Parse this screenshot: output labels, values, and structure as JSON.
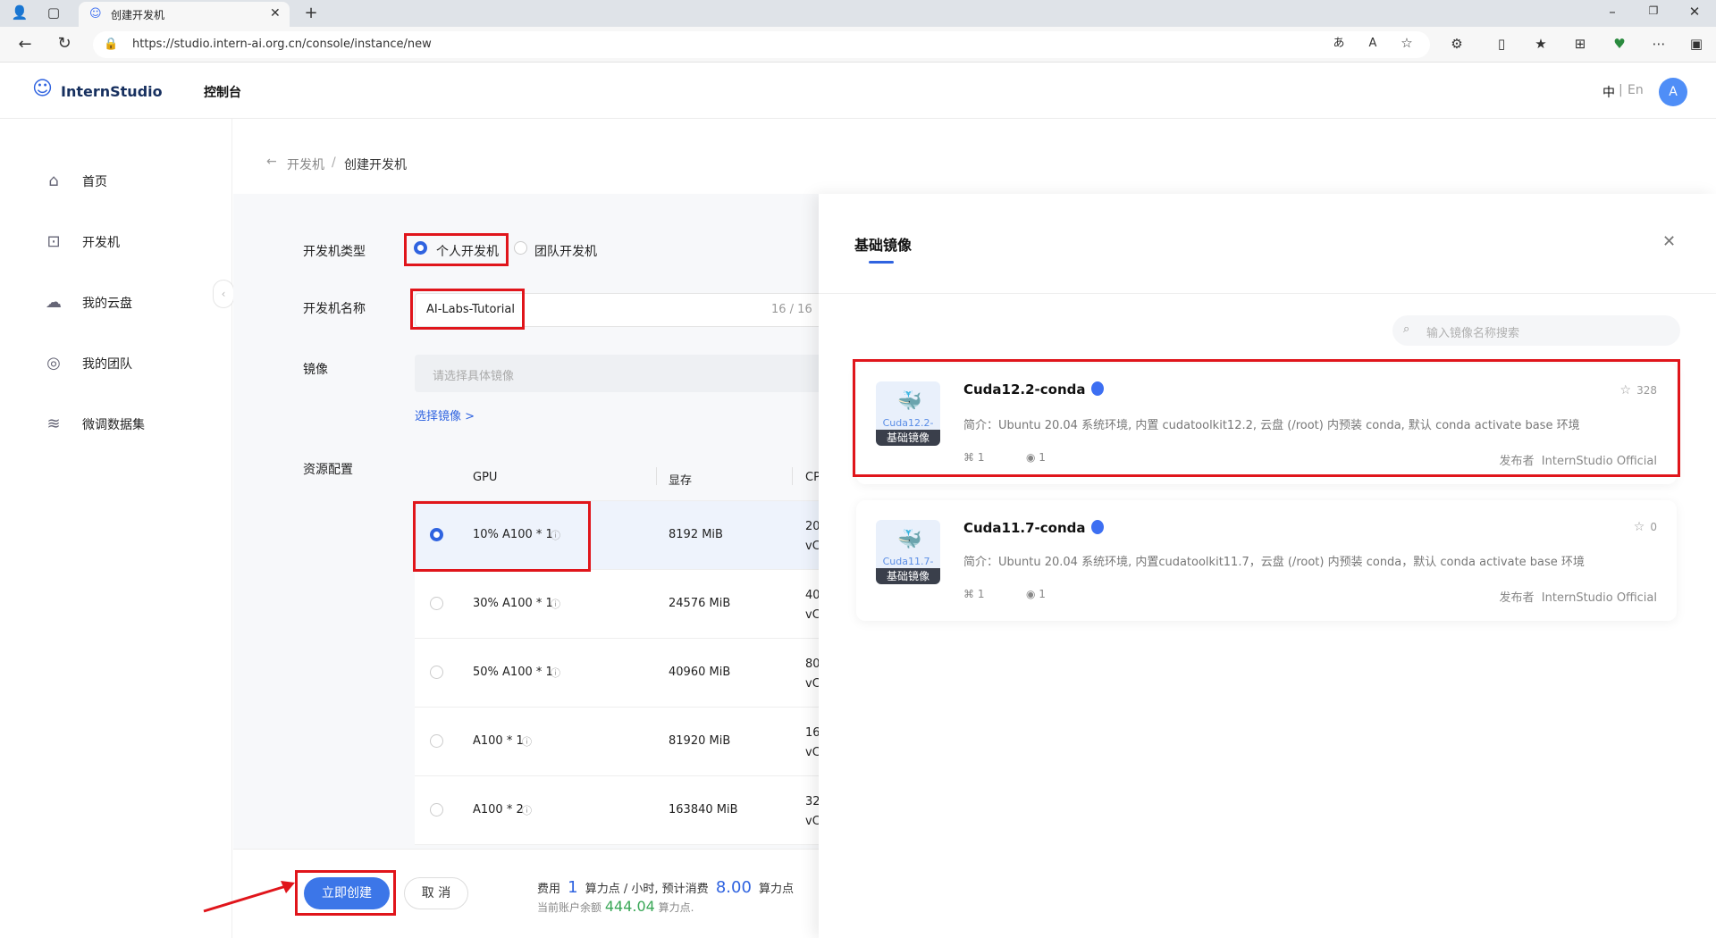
{
  "browser": {
    "tab_title": "创建开发机",
    "url": "https://studio.intern-ai.org.cn/console/instance/new"
  },
  "app": {
    "logo_text": "InternStudio",
    "console_label": "控制台",
    "lang_zh": "中",
    "lang_sep": "|",
    "lang_en": "En",
    "avatar_letter": "A"
  },
  "sidebar": {
    "items": [
      {
        "label": "首页",
        "icon": "home-icon"
      },
      {
        "label": "开发机",
        "icon": "terminal-icon"
      },
      {
        "label": "我的云盘",
        "icon": "cloud-icon"
      },
      {
        "label": "我的团队",
        "icon": "team-icon"
      },
      {
        "label": "微调数据集",
        "icon": "layers-icon"
      }
    ]
  },
  "breadcrumb": {
    "back_icon": "←",
    "parent": "开发机",
    "sep": "/",
    "current": "创建开发机"
  },
  "form": {
    "type_label": "开发机类型",
    "type_personal": "个人开发机",
    "type_team": "团队开发机",
    "name_label": "开发机名称",
    "name_value": "AI-Labs-Tutorial",
    "name_count": "16 / 16",
    "image_label": "镜像",
    "image_placeholder": "请选择具体镜像",
    "select_image_link": "选择镜像 >",
    "resource_label": "资源配置",
    "col_gpu": "GPU",
    "col_mem": "显存",
    "col_cpu": "CP",
    "gpu_rows": [
      {
        "gpu": "10% A100 * 1",
        "mem": "8192 MiB",
        "cpu1": "20",
        "cpu2": "vC",
        "selected": true
      },
      {
        "gpu": "30% A100 * 1",
        "mem": "24576 MiB",
        "cpu1": "40",
        "cpu2": "vC",
        "selected": false
      },
      {
        "gpu": "50% A100 * 1",
        "mem": "40960 MiB",
        "cpu1": "80",
        "cpu2": "vC",
        "selected": false
      },
      {
        "gpu": "A100 * 1",
        "mem": "81920 MiB",
        "cpu1": "16",
        "cpu2": "vC",
        "selected": false
      },
      {
        "gpu": "A100 * 2",
        "mem": "163840 MiB",
        "cpu1": "32",
        "cpu2": "vC",
        "selected": false
      }
    ]
  },
  "footer": {
    "create_button": "立即创建",
    "cancel_button": "取 消",
    "cost_prefix": "费用",
    "cost_value": "1",
    "cost_unit": "算力点 / 小时, 预计消费",
    "estimate_value": "8.00",
    "estimate_unit": "算力点",
    "balance_prefix": "当前账户余额",
    "balance_value": "444.04",
    "balance_unit": "算力点."
  },
  "panel": {
    "tab_label": "基础镜像",
    "search_placeholder": "输入镜像名称搜索",
    "cards": [
      {
        "title": "Cuda12.2-conda",
        "thumb_version": "Cuda12.2-",
        "thumb_tag": "基础镜像",
        "desc": "简介：Ubuntu 20.04 系统环境, 内置 cudatoolkit12.2, 云盘 (/root) 内预装 conda, 默认 conda activate base 环境",
        "forks": "1",
        "views": "1",
        "stars": "328",
        "publisher_label": "发布者",
        "publisher": "InternStudio Official"
      },
      {
        "title": "Cuda11.7-conda",
        "thumb_version": "Cuda11.7-",
        "thumb_tag": "基础镜像",
        "desc": "简介：Ubuntu 20.04 系统环境, 内置cudatoolkit11.7，云盘 (/root) 内预装 conda，默认 conda activate base 环境",
        "forks": "1",
        "views": "1",
        "stars": "0",
        "publisher_label": "发布者",
        "publisher": "InternStudio Official"
      }
    ]
  },
  "colors": {
    "accent": "#2f63e0",
    "highlight_red": "#e0151b",
    "green": "#3aa757"
  }
}
